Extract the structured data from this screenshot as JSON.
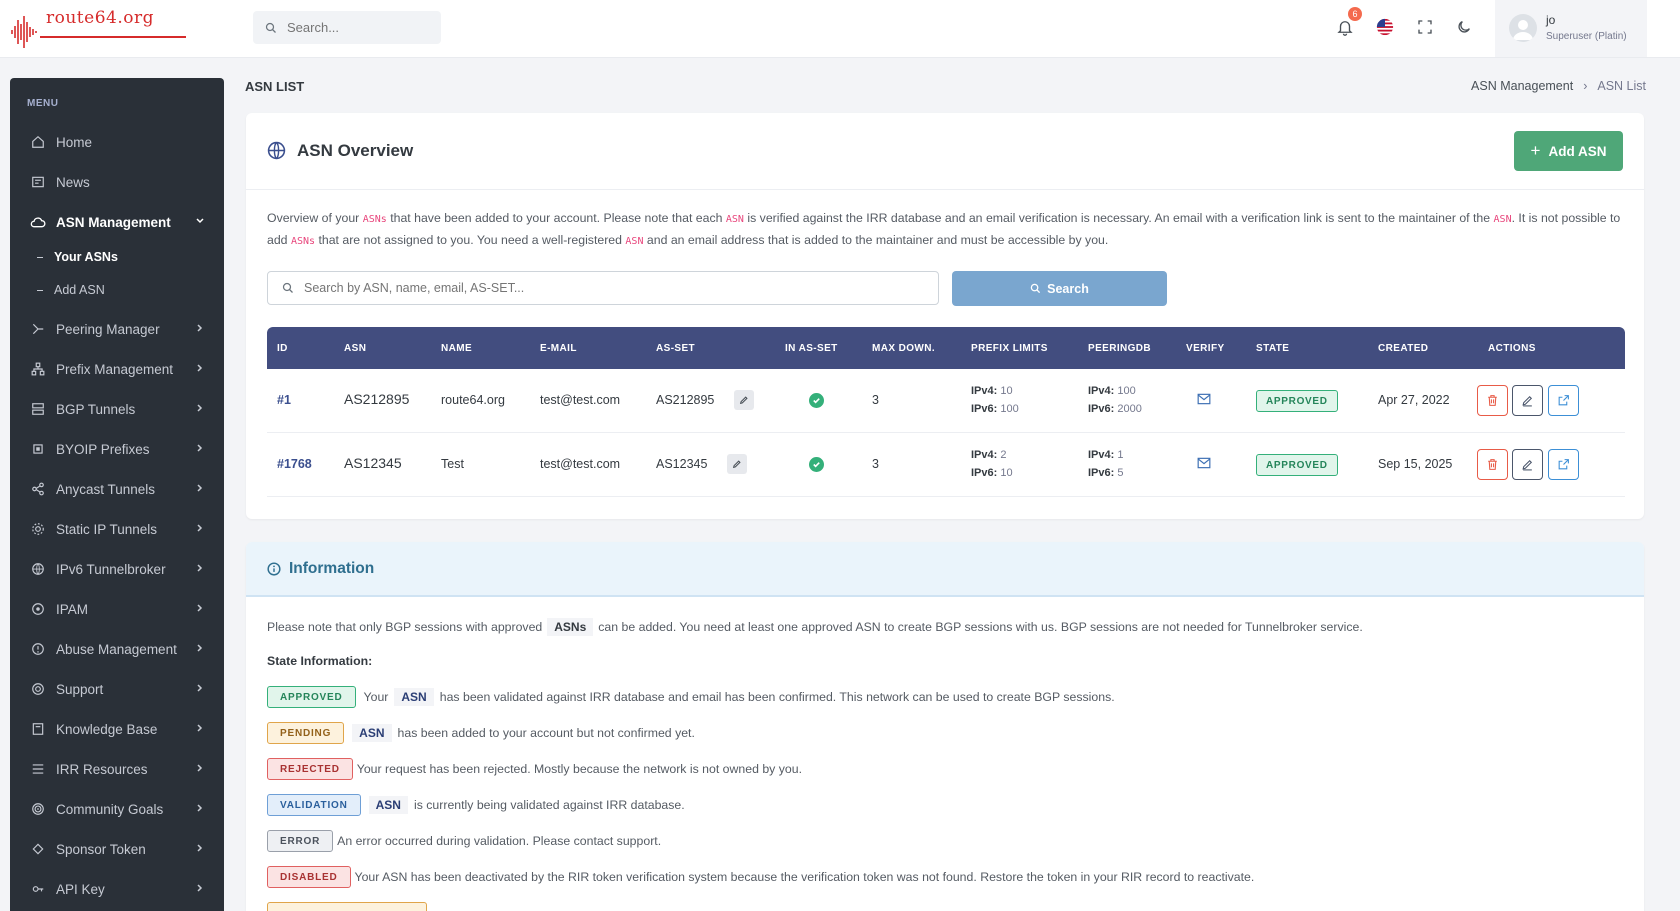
{
  "brand": {
    "logo_text": "route64.org"
  },
  "topbar": {
    "search_placeholder": "Search...",
    "notifications_count": "6",
    "user_name": "jo",
    "user_role": "Superuser (Platin)"
  },
  "sidebar": {
    "menu_title": "MENU",
    "items": [
      {
        "label": "Home",
        "icon": "home-icon"
      },
      {
        "label": "News",
        "icon": "news-icon"
      },
      {
        "label": "ASN Management",
        "icon": "cloud-icon"
      },
      {
        "label": "Peering Manager",
        "icon": "peering-icon"
      },
      {
        "label": "Prefix Management",
        "icon": "network-icon"
      },
      {
        "label": "BGP Tunnels",
        "icon": "server-icon"
      },
      {
        "label": "BYOIP Prefixes",
        "icon": "chip-icon"
      },
      {
        "label": "Anycast Tunnels",
        "icon": "share-icon"
      },
      {
        "label": "Static IP Tunnels",
        "icon": "settings-icon"
      },
      {
        "label": "IPv6 Tunnelbroker",
        "icon": "globe-icon"
      },
      {
        "label": "IPAM",
        "icon": "ipam-icon"
      },
      {
        "label": "Abuse Management",
        "icon": "alert-icon"
      },
      {
        "label": "Support",
        "icon": "support-icon"
      },
      {
        "label": "Knowledge Base",
        "icon": "book-icon"
      },
      {
        "label": "IRR Resources",
        "icon": "database-icon"
      },
      {
        "label": "Community Goals",
        "icon": "target-icon"
      },
      {
        "label": "Sponsor Token",
        "icon": "token-icon"
      },
      {
        "label": "API Key",
        "icon": "key-icon"
      }
    ],
    "subitems": [
      {
        "label": "Your ASNs"
      },
      {
        "label": "Add ASN"
      }
    ]
  },
  "page": {
    "title": "ASN LIST",
    "breadcrumb": [
      "ASN Management",
      "ASN List"
    ]
  },
  "overview": {
    "title": "ASN Overview",
    "add_button": "Add ASN",
    "intro": {
      "p1": "Overview of your ",
      "hl1": "ASNs",
      "p2": " that have been added to your account. Please note that each ",
      "hl2": "ASN",
      "p3": " is verified against the IRR database and an email verification is necessary. An email with a verification link is sent to the maintainer of the ",
      "hl3": "ASN",
      "p4": ". It is not possible to add ",
      "hl4": "ASNs",
      "p5": " that are not assigned to you. You need a well-registered ",
      "hl5": "ASN",
      "p6": " and an email address that is added to the maintainer and must be accessible by you."
    },
    "search_placeholder": "Search by ASN, name, email, AS-SET...",
    "search_button": "Search",
    "columns": [
      "ID",
      "ASN",
      "NAME",
      "E-MAIL",
      "AS-SET",
      "IN AS-SET",
      "MAX DOWN.",
      "PREFIX LIMITS",
      "PEERINGDB",
      "VERIFY",
      "STATE",
      "CREATED",
      "ACTIONS"
    ],
    "rows": [
      {
        "id": "#1",
        "asn": "AS212895",
        "name": "route64.org",
        "email": "test@test.com",
        "as_set": "AS212895",
        "max_down": "3",
        "prefix_v4_label": "IPv4:",
        "prefix_v4": "10",
        "prefix_v6_label": "IPv6:",
        "prefix_v6": "100",
        "pdb_v4_label": "IPv4:",
        "pdb_v4": "100",
        "pdb_v6_label": "IPv6:",
        "pdb_v6": "2000",
        "state": "APPROVED",
        "created": "Apr 27, 2022"
      },
      {
        "id": "#1768",
        "asn": "AS12345",
        "name": "Test",
        "email": "test@test.com",
        "as_set": "AS12345",
        "max_down": "3",
        "prefix_v4_label": "IPv4:",
        "prefix_v4": "2",
        "prefix_v6_label": "IPv6:",
        "prefix_v6": "10",
        "pdb_v4_label": "IPv4:",
        "pdb_v4": "1",
        "pdb_v6_label": "IPv6:",
        "pdb_v6": "5",
        "state": "APPROVED",
        "created": "Sep 15, 2025"
      }
    ]
  },
  "information": {
    "title": "Information",
    "note_before": "Please note that only BGP sessions with approved",
    "note_pill": "ASNs",
    "note_after": "can be added. You need at least one approved ASN to create BGP sessions with us. BGP sessions are not needed for Tunnelbroker service.",
    "state_info_title": "State Information:",
    "states": [
      {
        "badge": "APPROVED",
        "pre": "Your",
        "pill": "ASN",
        "text": "has been validated against IRR database and email has been confirmed. This network can be used to create BGP sessions."
      },
      {
        "badge": "PENDING",
        "pre": "",
        "pill": "ASN",
        "text": "has been added to your account but not confirmed yet."
      },
      {
        "badge": "REJECTED",
        "pre": "",
        "pill": "",
        "text": "Your request has been rejected. Mostly because the network is not owned by you."
      },
      {
        "badge": "VALIDATION",
        "pre": "",
        "pill": "ASN",
        "text": "is currently being validated against IRR database."
      },
      {
        "badge": "ERROR",
        "pre": "",
        "pill": "",
        "text": "An error occurred during validation. Please contact support."
      },
      {
        "badge": "DISABLED",
        "pre": "",
        "pill": "",
        "text": "Your ASN has been deactivated by the RIR token verification system because the verification token was not found. Restore the token in your RIR record to reactivate."
      }
    ]
  },
  "colors": {
    "sidebar_bg": "#2a3038",
    "table_header": "#424d7f",
    "primary_green": "#4fa778",
    "search_button": "#7aa6cf",
    "accent_red": "#d62b2b"
  }
}
